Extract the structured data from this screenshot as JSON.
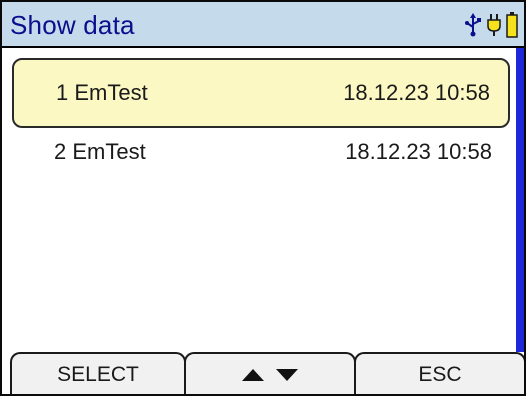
{
  "header": {
    "title": "Show data",
    "icons": [
      "usb-icon",
      "power-plug-icon",
      "battery-icon"
    ]
  },
  "list": {
    "items": [
      {
        "name": "1 EmTest",
        "date": "18.12.23 10:58",
        "selected": true
      },
      {
        "name": "2 EmTest",
        "date": "18.12.23 10:58",
        "selected": false
      }
    ]
  },
  "softkeys": {
    "select_label": "SELECT",
    "up_icon": "arrow-up-icon",
    "down_icon": "arrow-down-icon",
    "esc_label": "ESC"
  },
  "colors": {
    "header_bg": "#c5dbeb",
    "title_text": "#0b0e8d",
    "selection_bg": "#fbf8c3",
    "scrollbar": "#1d28d8",
    "softkey_bg": "#f1f1f1"
  }
}
